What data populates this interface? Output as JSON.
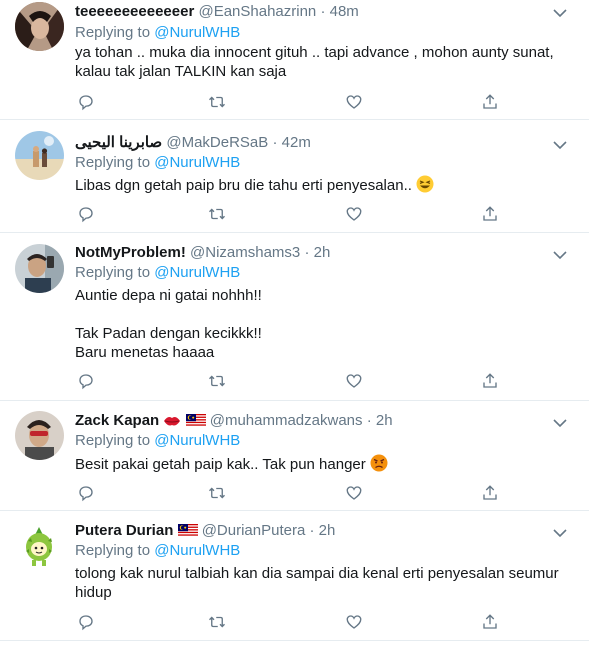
{
  "reply_prefix": "Replying to",
  "tweets": [
    {
      "name": "teeeeeeeeeeeeer",
      "handle": "@EanShahazrinn",
      "dot": "·",
      "time": "48m",
      "reply_to": "@NurulWHB",
      "text_lines": [
        "ya tohan .. muka dia innocent gituh .. tapi advance , mohon aunty sunat,",
        "kalau tak jalan TALKIN kan saja"
      ]
    },
    {
      "name": "صابرينا اليحيى",
      "handle": "@MakDeRSaB",
      "dot": "·",
      "time": "42m",
      "reply_to": "@NurulWHB",
      "text_lines": [
        "Libas dgn getah paip bru die tahu erti penyesalan.."
      ],
      "emoji": "grinning-squinting-face"
    },
    {
      "name": "NotMyProblem!",
      "handle": "@Nizamshams3",
      "dot": "·",
      "time": "2h",
      "reply_to": "@NurulWHB",
      "text_lines": [
        "Auntie depa ni gatai nohhh!!",
        "",
        "Tak Padan dengan kecikkk!!",
        "Baru menetas haaaa"
      ]
    },
    {
      "name": "Zack Kapan",
      "handle": "@muhammadzakwans",
      "dot": "·",
      "time": "2h",
      "reply_to": "@NurulWHB",
      "text_lines": [
        "Besit pakai getah paip kak.. Tak pun hanger"
      ],
      "emoji": "angry-face"
    },
    {
      "name": "Putera Durian",
      "handle": "@DurianPutera",
      "dot": "·",
      "time": "2h",
      "reply_to": "@NurulWHB",
      "text_lines": [
        "tolong kak nurul talbiah kan dia sampai dia kenal erti penyesalan seumur",
        "hidup"
      ]
    }
  ],
  "colors": {
    "link": "#1da1f2",
    "muted": "#657786",
    "text": "#14171a",
    "border": "#e6ecf0"
  },
  "icons": [
    "reply-icon",
    "retweet-icon",
    "like-icon",
    "share-icon",
    "chevron-down-icon"
  ]
}
